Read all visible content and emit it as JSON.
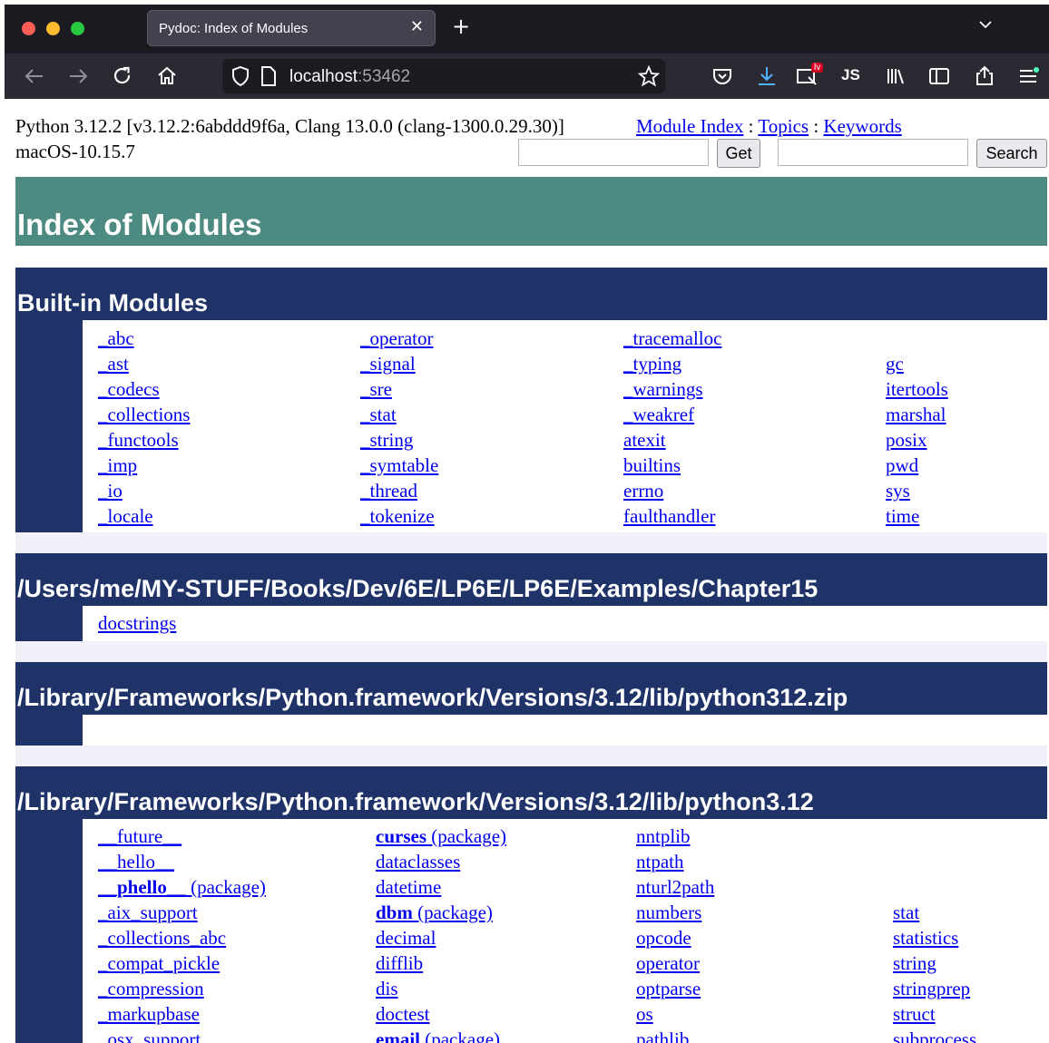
{
  "browser": {
    "tab_title": "Pydoc: Index of Modules",
    "url_host": "localhost",
    "url_port": ":53462",
    "extension_badge": "lv"
  },
  "header": {
    "python_version": "Python 3.12.2 [v3.12.2:6abddd9f6a, Clang 13.0.0 (clang-1300.0.29.30)]",
    "platform": "macOS-10.15.7",
    "module_index_link": "Module Index",
    "topics_link": "Topics",
    "keywords_link": "Keywords",
    "sep": ":",
    "get_button": "Get",
    "search_button": "Search",
    "get_value": "",
    "search_value": ""
  },
  "page_title": "Index of Modules",
  "sections": {
    "builtin": {
      "title": "Built-in Modules",
      "columns": [
        [
          "_abc",
          "_ast",
          "_codecs",
          "_collections",
          "_functools",
          "_imp",
          "_io",
          "_locale"
        ],
        [
          "_operator",
          "_signal",
          "_sre",
          "_stat",
          "_string",
          "_symtable",
          "_thread",
          "_tokenize"
        ],
        [
          "_tracemalloc",
          "_typing",
          "_warnings",
          "_weakref",
          "atexit",
          "builtins",
          "errno",
          "faulthandler"
        ],
        [
          "",
          "gc",
          "itertools",
          "marshal",
          "posix",
          "pwd",
          "sys",
          "time"
        ]
      ]
    },
    "chapter15": {
      "title": "/Users/me/MY-STUFF/Books/Dev/6E/LP6E/LP6E/Examples/Chapter15",
      "modules": [
        "docstrings"
      ]
    },
    "zip": {
      "title": "/Library/Frameworks/Python.framework/Versions/3.12/lib/python312.zip"
    },
    "lib": {
      "title": "/Library/Frameworks/Python.framework/Versions/3.12/lib/python3.12",
      "columns": [
        [
          {
            "name": "__future__",
            "pkg": ""
          },
          {
            "name": "__hello__",
            "pkg": ""
          },
          {
            "name": "__phello__",
            "pkg": " (package)"
          },
          {
            "name": "_aix_support",
            "pkg": ""
          },
          {
            "name": "_collections_abc",
            "pkg": ""
          },
          {
            "name": "_compat_pickle",
            "pkg": ""
          },
          {
            "name": "_compression",
            "pkg": ""
          },
          {
            "name": "_markupbase",
            "pkg": ""
          },
          {
            "name": "_osx_support",
            "pkg": ""
          }
        ],
        [
          {
            "name": "curses",
            "pkg": " (package)"
          },
          {
            "name": "dataclasses",
            "pkg": ""
          },
          {
            "name": "datetime",
            "pkg": ""
          },
          {
            "name": "dbm",
            "pkg": " (package)"
          },
          {
            "name": "decimal",
            "pkg": ""
          },
          {
            "name": "difflib",
            "pkg": ""
          },
          {
            "name": "dis",
            "pkg": ""
          },
          {
            "name": "doctest",
            "pkg": ""
          },
          {
            "name": "email",
            "pkg": " (package)"
          }
        ],
        [
          {
            "name": "nntplib",
            "pkg": ""
          },
          {
            "name": "ntpath",
            "pkg": ""
          },
          {
            "name": "nturl2path",
            "pkg": ""
          },
          {
            "name": "numbers",
            "pkg": ""
          },
          {
            "name": "opcode",
            "pkg": ""
          },
          {
            "name": "operator",
            "pkg": ""
          },
          {
            "name": "optparse",
            "pkg": ""
          },
          {
            "name": "os",
            "pkg": ""
          },
          {
            "name": "pathlib",
            "pkg": ""
          }
        ],
        [
          {
            "name": "",
            "pkg": ""
          },
          {
            "name": "",
            "pkg": ""
          },
          {
            "name": "",
            "pkg": ""
          },
          {
            "name": "stat",
            "pkg": ""
          },
          {
            "name": "statistics",
            "pkg": ""
          },
          {
            "name": "string",
            "pkg": ""
          },
          {
            "name": "stringprep",
            "pkg": ""
          },
          {
            "name": "struct",
            "pkg": ""
          },
          {
            "name": "subprocess",
            "pkg": ""
          }
        ]
      ]
    }
  },
  "colors": {
    "title_bar": "#4d8b82",
    "section_bar": "#1f3368",
    "link": "#0000ee",
    "chrome_dark": "#1c1b22",
    "chrome_nav": "#2b2a33"
  },
  "icons": [
    "back-icon",
    "forward-icon",
    "reload-icon",
    "home-icon",
    "shield-icon",
    "page-icon",
    "bookmark-star-icon",
    "pocket-icon",
    "download-icon",
    "extension-icon",
    "js-icon",
    "library-icon",
    "sidebar-icon",
    "share-icon",
    "menu-icon",
    "tab-list-chevron-icon"
  ]
}
